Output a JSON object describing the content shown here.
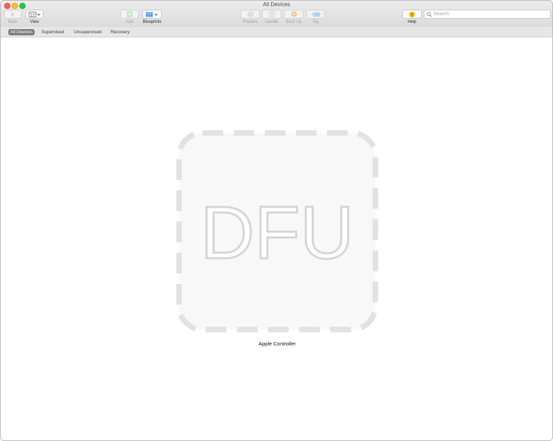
{
  "window": {
    "title": "All Devices"
  },
  "toolbar": {
    "back_label": "Back",
    "view_label": "View",
    "add_label": "Add",
    "blueprints_label": "Blueprints",
    "prepare_label": "Prepare",
    "update_label": "Update",
    "backup_label": "Back Up",
    "tag_label": "Tag",
    "help_label": "Help",
    "help_glyph": "?"
  },
  "search": {
    "placeholder": "Search",
    "value": ""
  },
  "filters": [
    {
      "label": "All Devices",
      "active": true
    },
    {
      "label": "Supervised",
      "active": false
    },
    {
      "label": "Unsupervised",
      "active": false
    },
    {
      "label": "Recovery",
      "active": false
    }
  ],
  "device": {
    "badge_text": "DFU",
    "name": "Apple Controller"
  },
  "colors": {
    "close": "#fe5f57",
    "minimize": "#febc2e",
    "zoom": "#28c840",
    "add_icon": "#7ed08a",
    "blueprints_icon": "#4e9bf5",
    "backup_icon": "#f5a25a",
    "tag_icon": "#6fb2ea",
    "help_icon": "#f5c518",
    "selected_filter": "#7b7b7b"
  }
}
